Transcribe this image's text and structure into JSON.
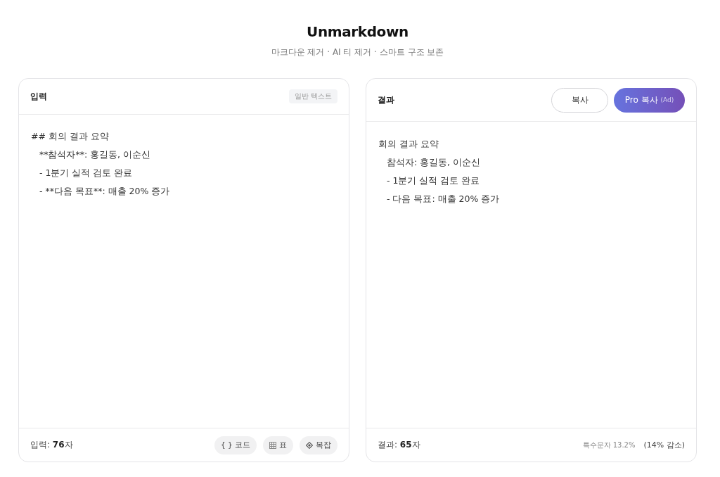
{
  "header": {
    "title": "Unmarkdown",
    "subtitle": "마크다운 제거 · AI 티 제거 · 스마트 구조 보존"
  },
  "input_panel": {
    "title": "입력",
    "badge": "일반 텍스트",
    "value": "## 회의 결과 요약\n   **참석자**: 홍길동, 이순신\n   - 1분기 실적 검토 완료\n   - **다음 목표**: 매출 20% 증가",
    "count": "입력: **76**자",
    "chips": [
      {
        "kind": "code",
        "label": "{ } 코드"
      },
      {
        "kind": "table",
        "label": "표"
      },
      {
        "kind": "complex",
        "label": "복잡"
      }
    ]
  },
  "output_panel": {
    "title": "결과",
    "buttons": [
      {
        "kind": "outline",
        "label": "복사"
      },
      {
        "kind": "pro",
        "label": "Pro 복사",
        "tag": "(Ad)"
      }
    ],
    "text": "회의 결과 요약\n   참석자: 홍길동, 이순신\n   - 1분기 실적 검토 완료\n   - 다음 목표: 매출 20% 증가",
    "count": "결과: **65**자",
    "special_chars": "특수문자 13.2%",
    "reduction": "(14% 감소)"
  }
}
